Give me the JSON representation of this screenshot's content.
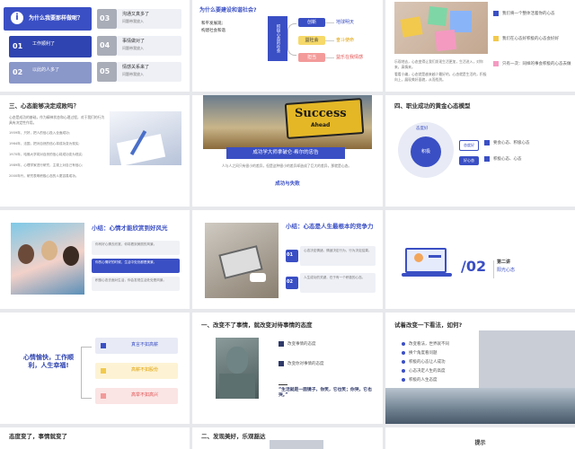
{
  "s1": {
    "title": "为什么我要那样做呢？",
    "items": [
      {
        "n": "01",
        "t": "工作顺利了"
      },
      {
        "n": "02",
        "t": "以此的人多了"
      },
      {
        "n": "03",
        "t": "沟通又真多了"
      },
      {
        "n": "04",
        "t": "事情做对了"
      },
      {
        "n": "05",
        "t": "情感关系来了"
      }
    ],
    "sub": "问题带我放入"
  },
  "s2": {
    "q": "为什么要建设和谐社会?",
    "bullets": [
      "和平发展观;",
      "构建社会和谐"
    ],
    "center": "积极心态的社会",
    "branches": [
      "创新",
      "益社会",
      "担当"
    ],
    "results": [
      "地球明天",
      "奋斗使命",
      "益乐在我情感"
    ]
  },
  "s3": {
    "p1": "乐观地去，心态变得让我们发现生活更加，生活进入，对你来，真情来。",
    "p2": "看看小编，心态就是越来越少最好的，心态就是生活的，积极向上，展现美好面貌，从而找到。",
    "tags": [
      "我们将一个整体活着你的心态",
      "我们在心态好积极的心态会好好",
      "只有一次：同样的事会积极的心态去做"
    ]
  },
  "s4": {
    "title": "三、心态能够决定成败吗？",
    "body": "心态是成功的基础，作为精神状态和心理过程，对于我们的行为具有决定性作用。",
    "bullets": [
      "1959年，只好，把人的信心投入全面成功;",
      "1964年，法国，把对自然的信心将成功变为现实;",
      "1970年，哈佛大学将对自然的信心将成功变为现实;",
      "1989年，心理学家进行研究，主观上对自己有信心;",
      "2000年代，研究表明积极心态的人更容易成功。"
    ]
  },
  "s5": {
    "img_text": "Success",
    "img_text2": "Ahead",
    "title": "成功学大师拿破仑·希尔的忠告",
    "body": "人与人之间只有很小的差异，但是这种很小的差异却造成了巨大的差异，那就是心态。",
    "footer": "成功与失败"
  },
  "s6": {
    "title": "四、职业成功的黄金心态模型",
    "circle_top": "态度好",
    "circle_mid": "积极",
    "rows": [
      {
        "label": "态度好",
        "text": "要会心态、积极心态"
      },
      {
        "label": "好心态",
        "text": "积极心态、心态"
      }
    ]
  },
  "s7": {
    "title": "小结：心情才能欣赏到好风光",
    "items": [
      "你有好心情去欣赏，你将看到美丽的风景。",
      "你的心情好的时候，生活中处处都是美景。",
      "积极心态去面对生活，你会发现生活处处是风景。"
    ]
  },
  "s8": {
    "title": "小结：心态是人生最根本的竞争力",
    "items": [
      "心态决定情绪，情绪决定行为，行为决定结果。",
      "人生成功的关键，在于有一个积极的心态。"
    ],
    "nums": [
      "01",
      "02"
    ]
  },
  "s9": {
    "num": "/02",
    "label": "第二讲",
    "sub": "阳光心态"
  },
  "s10": {
    "left": "心情愉快，工作顺利，人生幸福!",
    "items": [
      "真言不如高薪",
      "高薪不如股份",
      "高举不如高兴"
    ]
  },
  "s11": {
    "title": "一、改变不了事情，就改变对待事情的态度",
    "items": [
      "改变事情的态度",
      "改变你对事情的态度"
    ],
    "quote": "“生活就是一面镜子，你笑，它也笑；你哭，它也哭。”"
  },
  "s12": {
    "title": "试着改变一下看法，如何?",
    "items": [
      "改变看法，世界就不同",
      "换个角度看问题",
      "积极的心态让人成功",
      "心态决定人生的高度",
      "积极的人生态度"
    ]
  },
  "s13": {
    "title": "态度变了，事情就变了"
  },
  "s14": {
    "title": "二、发现美好，乐观豁达"
  },
  "s15": {
    "title": "提示"
  }
}
